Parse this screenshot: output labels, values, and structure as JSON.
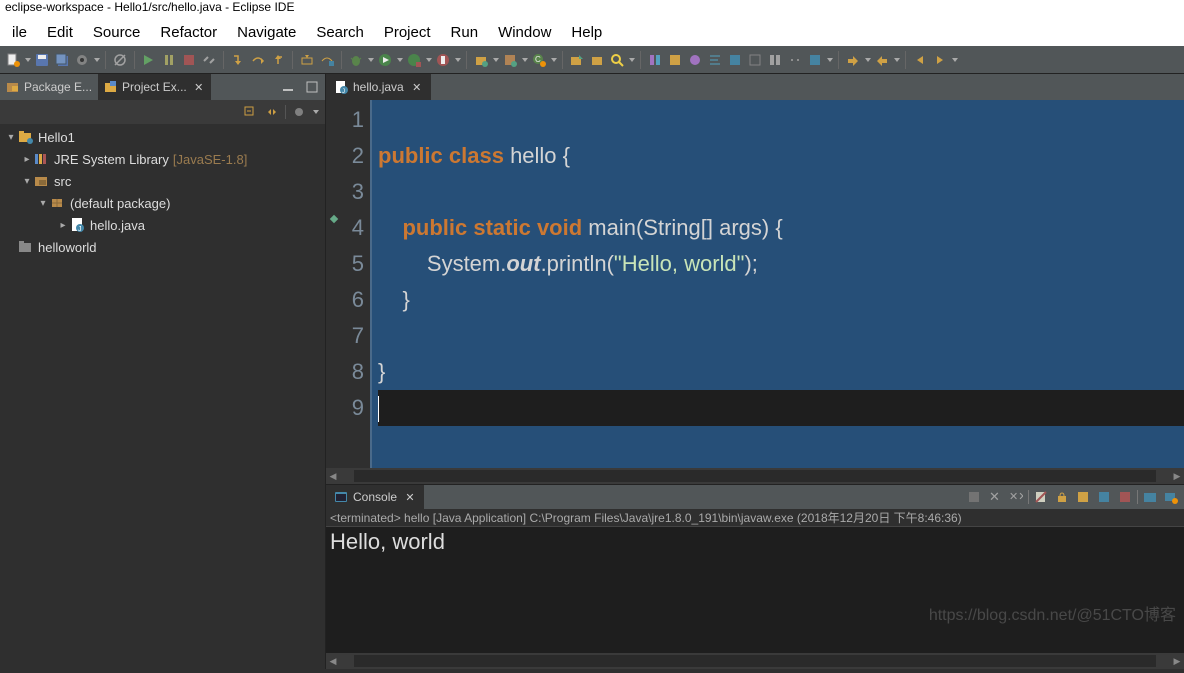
{
  "title": "eclipse-workspace - Hello1/src/hello.java - Eclipse IDE",
  "menu": [
    "ile",
    "Edit",
    "Source",
    "Refactor",
    "Navigate",
    "Search",
    "Project",
    "Run",
    "Window",
    "Help"
  ],
  "left_tabs": [
    {
      "label": "Package E...",
      "active": false
    },
    {
      "label": "Project Ex...",
      "active": true
    }
  ],
  "tree": {
    "project1": {
      "name": "Hello1"
    },
    "jre": {
      "name": "JRE System Library",
      "tag": "[JavaSE-1.8]"
    },
    "src": {
      "name": "src"
    },
    "pkg": {
      "name": "(default package)"
    },
    "file": {
      "name": "hello.java"
    },
    "project2": {
      "name": "helloworld"
    }
  },
  "editor_tab": "hello.java",
  "code": {
    "lines": [
      "1",
      "2",
      "3",
      "4",
      "5",
      "6",
      "7",
      "8",
      "9"
    ],
    "l2a": "public",
    "l2b": " class",
    "l2c": " hello {",
    "l4a": "    public",
    "l4b": " static",
    "l4c": " void",
    "l4d": " main(String[] args) {",
    "l5a": "        System.",
    "l5b": "out",
    "l5c": ".println(",
    "l5d": "\"Hello, world\"",
    "l5e": ");",
    "l6": "    }",
    "l8": "}"
  },
  "console": {
    "tab": "Console",
    "status": "<terminated> hello [Java Application] C:\\Program Files\\Java\\jre1.8.0_191\\bin\\javaw.exe (2018年12月20日 下午8:46:36)",
    "output": "Hello, world"
  },
  "watermark": "https://blog.csdn.net/@51CTO博客"
}
